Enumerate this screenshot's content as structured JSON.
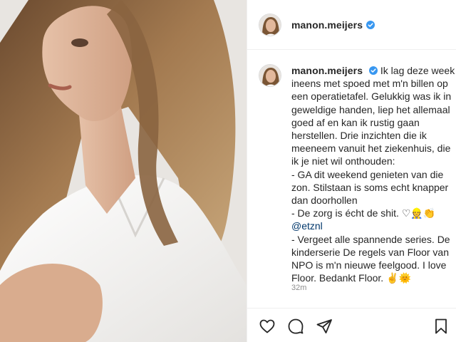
{
  "post": {
    "username": "manon.meijers",
    "verified": true,
    "caption_parts": {
      "intro": " Ik lag deze week ineens met spoed met m'n billen op een operatietafel. Gelukkig was ik in geweldige handen, liep het allemaal goed af en kan ik rustig gaan herstellen. Drie inzichten die ik meeneem vanuit het ziekenhuis, die ik je niet wil onthouden:\n- GA dit weekend genieten van die zon. Stilstaan is soms echt knapper dan doorhollen\n- De zorg is écht de shit. ♡👷👏\n",
      "mention": "@etznl",
      "outro": "\n- Vergeet alle spannende series. De kinderserie De regels van Floor van NPO is m'n nieuwe feelgood. I love Floor. Bedankt Floor. ✌🌞"
    },
    "timestamp": "32m"
  },
  "icons": {
    "verified": "verified-badge-icon",
    "like": "heart-icon",
    "comment": "comment-bubble-icon",
    "share": "paper-plane-icon",
    "save": "bookmark-icon"
  },
  "colors": {
    "verified": "#3897f0",
    "text": "#262626",
    "muted": "#8e8e8e",
    "mention": "#00376b",
    "border": "#efefef"
  }
}
